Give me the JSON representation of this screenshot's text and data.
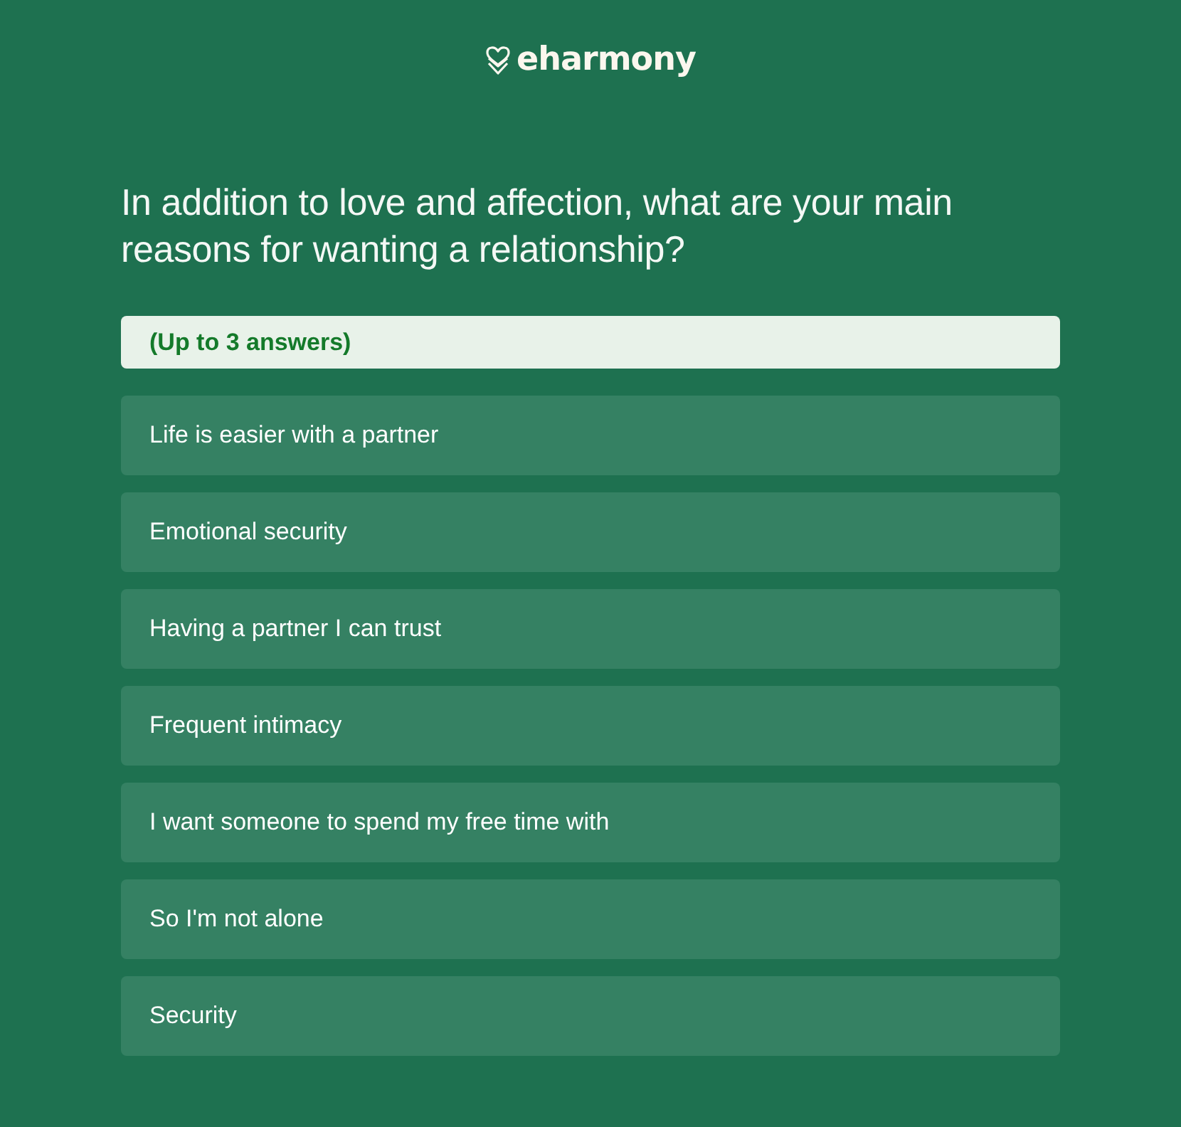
{
  "header": {
    "logo_text": "eharmony"
  },
  "question": "In addition to love and affection, what are your main reasons for wanting a relationship?",
  "hint": "(Up to 3 answers)",
  "options": [
    {
      "label": "Life is easier with a partner",
      "selected": false
    },
    {
      "label": "Emotional security",
      "selected": false
    },
    {
      "label": "Having a partner I can trust",
      "selected": false
    },
    {
      "label": "Frequent intimacy",
      "selected": false
    },
    {
      "label": "I want someone to spend my free time with",
      "selected": false
    },
    {
      "label": "So I'm not alone",
      "selected": false
    },
    {
      "label": "Security",
      "selected": false
    }
  ]
}
